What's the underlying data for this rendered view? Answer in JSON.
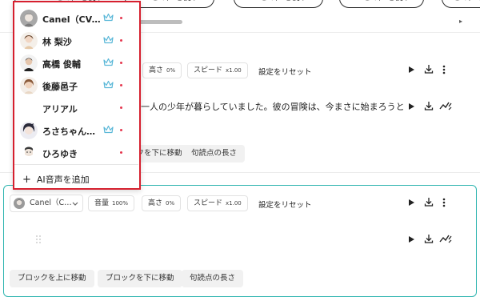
{
  "colors": {
    "accent_teal": "#2fb5b0",
    "highlight_red": "#d6202f",
    "premium_crown": "#5bb8d8",
    "dot_pink": "#e53950"
  },
  "top_strip": {
    "use_voice_label": "＋ この声を使う",
    "scroll_arrow": "▸"
  },
  "block1": {
    "height_label": "高さ",
    "height_value": "0%",
    "speed_label": "スピード",
    "speed_value": "x1.00",
    "reset_label": "設定をリセット",
    "text": "一人の少年が暮らしていました。彼の冒険は、今まさに始まろうとし",
    "move_down_label": "ブロックを下に移動",
    "pause_length_label": "句読点の長さ"
  },
  "block2": {
    "voice_name": "Canel（C…",
    "volume_label": "音量",
    "volume_value": "100%",
    "height_label": "高さ",
    "height_value": "0%",
    "speed_label": "スピード",
    "speed_value": "x1.00",
    "reset_label": "設定をリセット",
    "move_up_label": "ブロックを上に移動",
    "move_down_label": "ブロックを下に移動",
    "pause_length_label": "句読点の長さ"
  },
  "voice_dropdown": {
    "items": [
      {
        "name": "Canel（CV:…",
        "premium": true,
        "icon": "avatar-canel-icon"
      },
      {
        "name": "林 梨沙",
        "premium": true,
        "icon": "avatar-hayashi-icon"
      },
      {
        "name": "高橋 俊輔",
        "premium": true,
        "icon": "avatar-takahashi-icon"
      },
      {
        "name": "後藤邑子",
        "premium": true,
        "icon": "avatar-goto-icon"
      },
      {
        "name": "アリアル",
        "premium": false,
        "icon": ""
      },
      {
        "name": "ろさちゃん…",
        "premium": true,
        "icon": "avatar-rosa-icon"
      },
      {
        "name": "ひろゆき",
        "premium": false,
        "icon": "avatar-hiroyuki-icon"
      }
    ],
    "add_label": "AI音声を追加",
    "add_icon": "plus-icon"
  },
  "icons": {
    "play": "play-icon",
    "download": "download-icon",
    "more": "more-vertical-icon",
    "waveform": "waveform-icon",
    "chevron": "chevron-down-icon",
    "crown": "crown-icon",
    "drag": "drag-handle-icon"
  }
}
